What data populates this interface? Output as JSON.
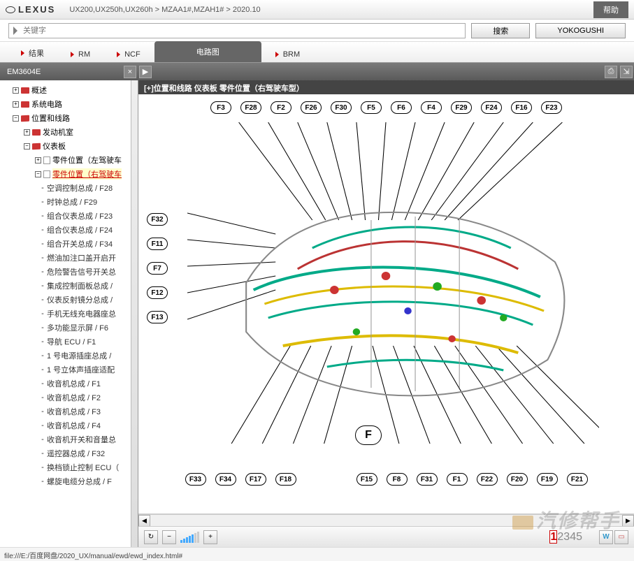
{
  "header": {
    "brand": "LEXUS",
    "breadcrumb": "UX200,UX250h,UX260h  >  MZAA1#,MZAH1#  >  2020.10",
    "help": "帮助"
  },
  "search": {
    "placeholder": "关键字",
    "search_btn": "搜索",
    "yokogushi_btn": "YOKOGUSHI"
  },
  "tabs": {
    "result": "结果",
    "rm": "RM",
    "ncf": "NCF",
    "active": "电路图",
    "brm": "BRM"
  },
  "doc": {
    "id": "EM3604E"
  },
  "tree": {
    "n1": "概述",
    "n2": "系统电路",
    "n3": "位置和线路",
    "n3a": "发动机室",
    "n3b": "仪表板",
    "n3b1": "零件位置（左驾驶车",
    "n3b2": "零件位置（右驾驶车",
    "leaves": [
      "空调控制总成 / F28",
      "时钟总成 / F29",
      "组合仪表总成 / F23",
      "组合仪表总成 / F24",
      "组合开关总成 / F34",
      "燃油加注口盖开启开",
      "危险警告信号开关总",
      "集成控制面板总成 /",
      "仪表反射镜分总成 /",
      "手机无线充电器座总",
      "多功能显示屏 / F6",
      "导航 ECU / F1",
      "1 号电源插座总成 /",
      "1 号立体声插座适配",
      "收音机总成 / F1",
      "收音机总成 / F2",
      "收音机总成 / F3",
      "收音机总成 / F4",
      "收音机开关和音量总",
      "遥控器总成 / F32",
      "换档锁止控制 ECU（",
      "螺旋电缆分总成 / F"
    ]
  },
  "content": {
    "title": "[+]位置和线路   仪表板   零件位置（右驾驶车型）",
    "labels_top": [
      "F3",
      "F28",
      "F2",
      "F26",
      "F30",
      "F5",
      "F6",
      "F4",
      "F29",
      "F24",
      "F16",
      "F23"
    ],
    "labels_left": [
      "F32",
      "F11",
      "F7",
      "F12",
      "F13"
    ],
    "labels_bottom": [
      "F33",
      "F34",
      "F17",
      "F18",
      "F15",
      "F8",
      "F31",
      "F1",
      "F22",
      "F20",
      "F19",
      "F21"
    ],
    "big_label": "F"
  },
  "pager": {
    "pages": [
      "1",
      "2",
      "3",
      "4",
      "5"
    ],
    "current": "1",
    "w": "W"
  },
  "status": "file:///E:/百度网盘/2020_UX/manual/ewd/ewd_index.html#",
  "watermark": "汽修帮手"
}
